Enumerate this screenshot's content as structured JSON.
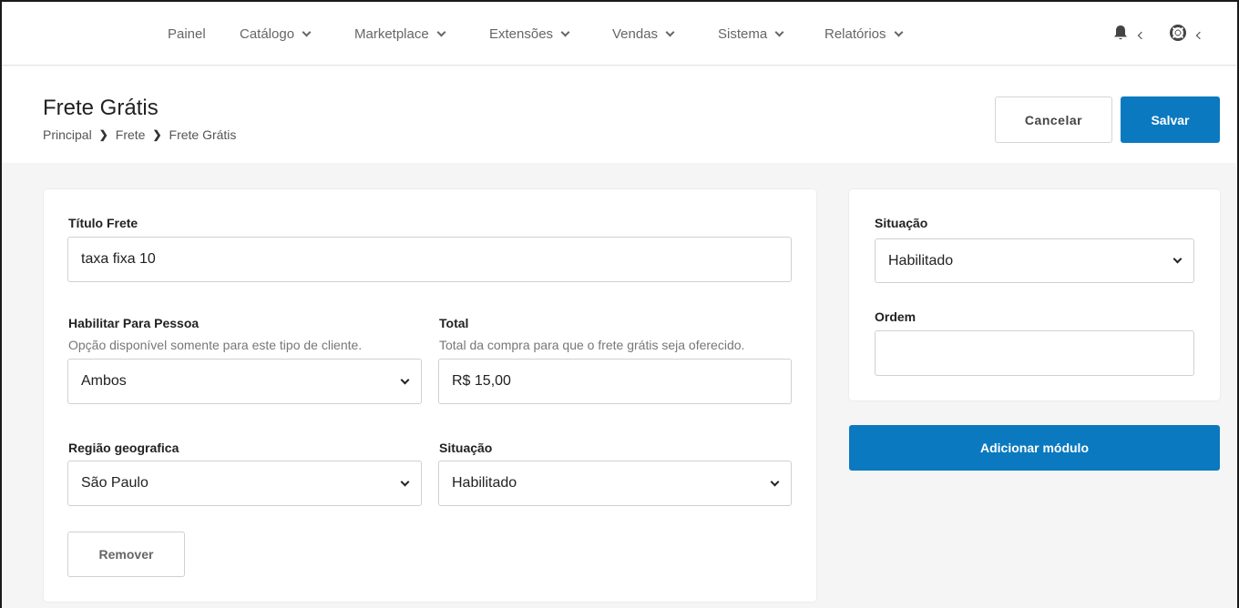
{
  "nav": {
    "items": [
      {
        "label": "Painel",
        "has_dropdown": false
      },
      {
        "label": "Catálogo",
        "has_dropdown": true
      },
      {
        "label": "Marketplace",
        "has_dropdown": true
      },
      {
        "label": "Extensões",
        "has_dropdown": true
      },
      {
        "label": "Vendas",
        "has_dropdown": true
      },
      {
        "label": "Sistema",
        "has_dropdown": true
      },
      {
        "label": "Relatórios",
        "has_dropdown": true
      }
    ],
    "icons": [
      "bell-icon",
      "lifebuoy-icon"
    ]
  },
  "header": {
    "title": "Frete Grátis",
    "breadcrumb": [
      "Principal",
      "Frete",
      "Frete Grátis"
    ],
    "cancel_label": "Cancelar",
    "save_label": "Salvar"
  },
  "main_form": {
    "title_label": "Título Frete",
    "title_value": "taxa fixa 10",
    "person_label": "Habilitar Para Pessoa",
    "person_hint": "Opção disponível somente para este tipo de cliente.",
    "person_value": "Ambos",
    "total_label": "Total",
    "total_hint": "Total da compra para que o frete grátis seja oferecido.",
    "total_value": "R$ 15,00",
    "region_label": "Região geografica",
    "region_value": "São Paulo",
    "status_label": "Situação",
    "status_value": "Habilitado",
    "remove_label": "Remover"
  },
  "side_form": {
    "status_label": "Situação",
    "status_value": "Habilitado",
    "order_label": "Ordem",
    "order_value": "",
    "add_module_label": "Adicionar módulo"
  },
  "colors": {
    "primary": "#0b79bf",
    "background": "#f5f5f5"
  }
}
